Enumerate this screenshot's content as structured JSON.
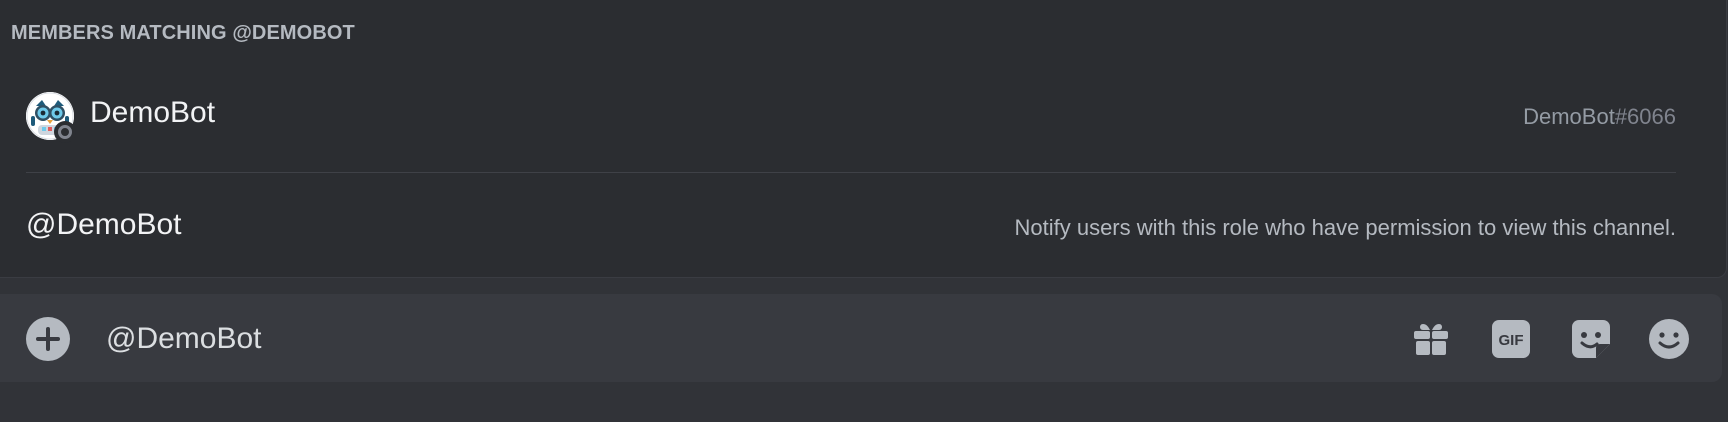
{
  "autocomplete": {
    "header": "MEMBERS MATCHING @DEMOBOT",
    "member": {
      "display_name": "DemoBot",
      "username": "DemoBot",
      "discriminator": "#6066"
    },
    "role": {
      "name": "@DemoBot",
      "description": "Notify users with this role who have permission to view this channel."
    }
  },
  "composer": {
    "value": "@DemoBot",
    "icons": [
      "plus-circle-icon",
      "gift-icon",
      "gif-icon",
      "sticker-icon",
      "emoji-icon"
    ],
    "gif_label": "GIF"
  },
  "colors": {
    "background": "#313338",
    "popup": "#2b2d31",
    "composer": "#383a40",
    "icon": "#b5bac1",
    "text": "#f2f3f5",
    "muted": "#949ba4"
  }
}
